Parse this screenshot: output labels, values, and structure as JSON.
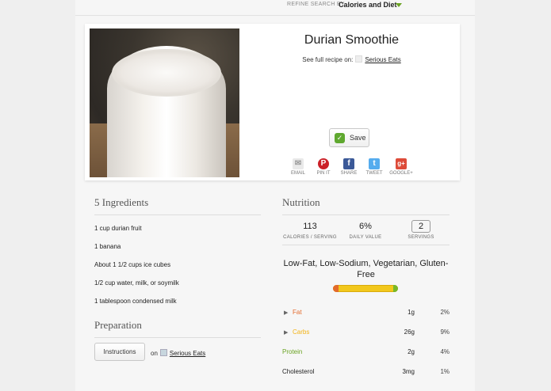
{
  "refine": {
    "label": "REFINE SEARCH BY",
    "value": "Calories and Diet"
  },
  "recipe": {
    "title": "Durian Smoothie",
    "source_prefix": "See full recipe on:",
    "source_name": "Serious Eats",
    "save_label": "Save"
  },
  "share": [
    {
      "label": "EMAIL",
      "icon": "email-icon",
      "color": "#e9e9e9"
    },
    {
      "label": "PIN IT",
      "icon": "pinterest-icon",
      "color": "#cb2027"
    },
    {
      "label": "SHARE",
      "icon": "facebook-icon",
      "color": "#3b5998"
    },
    {
      "label": "TWEET",
      "icon": "twitter-icon",
      "color": "#55acee"
    },
    {
      "label": "GOOGLE+",
      "icon": "google-plus-icon",
      "color": "#dd4b39"
    }
  ],
  "ingredients": {
    "heading": "5 Ingredients",
    "items": [
      "1 cup durian fruit",
      "1 banana",
      "About 1 1/2 cups ice cubes",
      "1/2 cup water, milk, or soymilk",
      "1 tablespoon condensed milk"
    ]
  },
  "preparation": {
    "heading": "Preparation",
    "button_label": "Instructions",
    "on_label": "on",
    "source_name": "Serious Eats"
  },
  "nutrition": {
    "heading": "Nutrition",
    "calories": {
      "value": "113",
      "label": "CALORIES / SERVING"
    },
    "daily": {
      "value": "6%",
      "label": "DAILY VALUE"
    },
    "servings": {
      "value": "2",
      "label": "SERVINGS"
    },
    "diet_labels": "Low-Fat, Low-Sodium, Vegetarian, Gluten-Free",
    "rows": [
      {
        "name": "Fat",
        "amount": "1g",
        "pct": "2%",
        "color": "#e36a2c",
        "expandable": true
      },
      {
        "name": "Carbs",
        "amount": "26g",
        "pct": "9%",
        "color": "#f2b316",
        "expandable": true
      },
      {
        "name": "Protein",
        "amount": "2g",
        "pct": "4%",
        "color": "#6aa322",
        "expandable": false
      },
      {
        "name": "Cholesterol",
        "amount": "3mg",
        "pct": "1%",
        "color": "#222222",
        "expandable": false
      }
    ]
  },
  "colors": {
    "accent_green": "#6aa322",
    "fat": "#e36a2c",
    "carbs": "#f2b316",
    "protein": "#6aa322"
  }
}
